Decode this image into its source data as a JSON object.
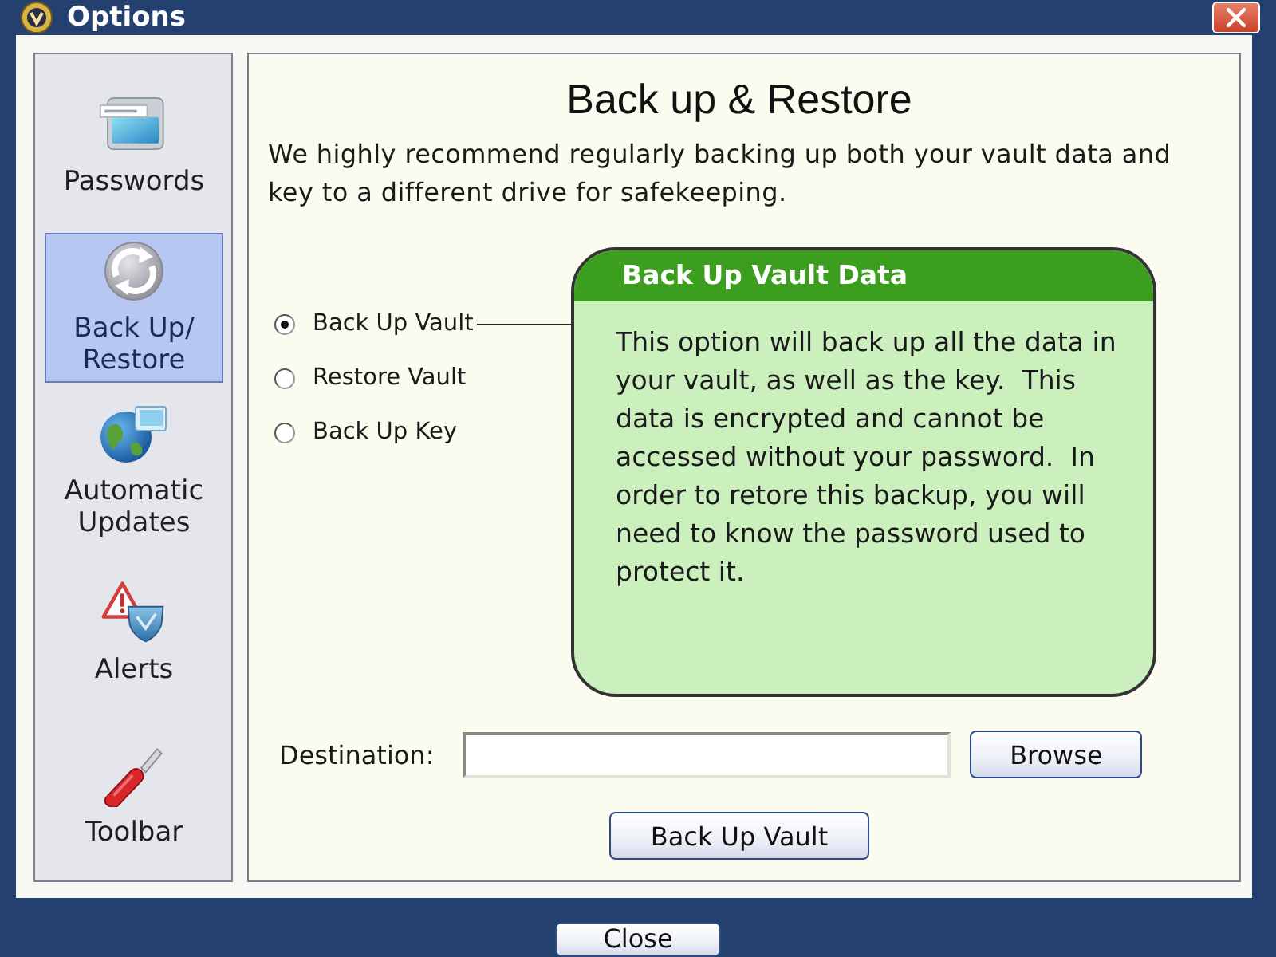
{
  "window": {
    "title": "Options"
  },
  "sidebar": {
    "items": [
      {
        "kind": "passwords",
        "label": "Passwords",
        "selected": false
      },
      {
        "kind": "backup",
        "label": "Back Up/ Restore",
        "selected": true
      },
      {
        "kind": "updates",
        "label": "Automatic Updates",
        "selected": false
      },
      {
        "kind": "alerts",
        "label": "Alerts",
        "selected": false
      },
      {
        "kind": "toolbar",
        "label": "Toolbar",
        "selected": false
      }
    ]
  },
  "main": {
    "title": "Back up & Restore",
    "description": "We highly recommend regularly backing up both your vault data and key to a different drive for safekeeping.",
    "options": [
      {
        "label": "Back Up Vault",
        "selected": true
      },
      {
        "label": "Restore Vault",
        "selected": false
      },
      {
        "label": "Back Up Key",
        "selected": false
      }
    ],
    "info_box": {
      "title": "Back Up Vault Data",
      "text": "This option will back up all the data in your vault, as well as the key.  This data is encrypted and cannot be accessed without your password.  In order to retore this backup, you will need to know the password used to protect it."
    },
    "destination": {
      "label": "Destination:",
      "browse_button": "Browse"
    },
    "action_button": "Back Up Vault"
  },
  "footer": {
    "close_button": "Close"
  }
}
